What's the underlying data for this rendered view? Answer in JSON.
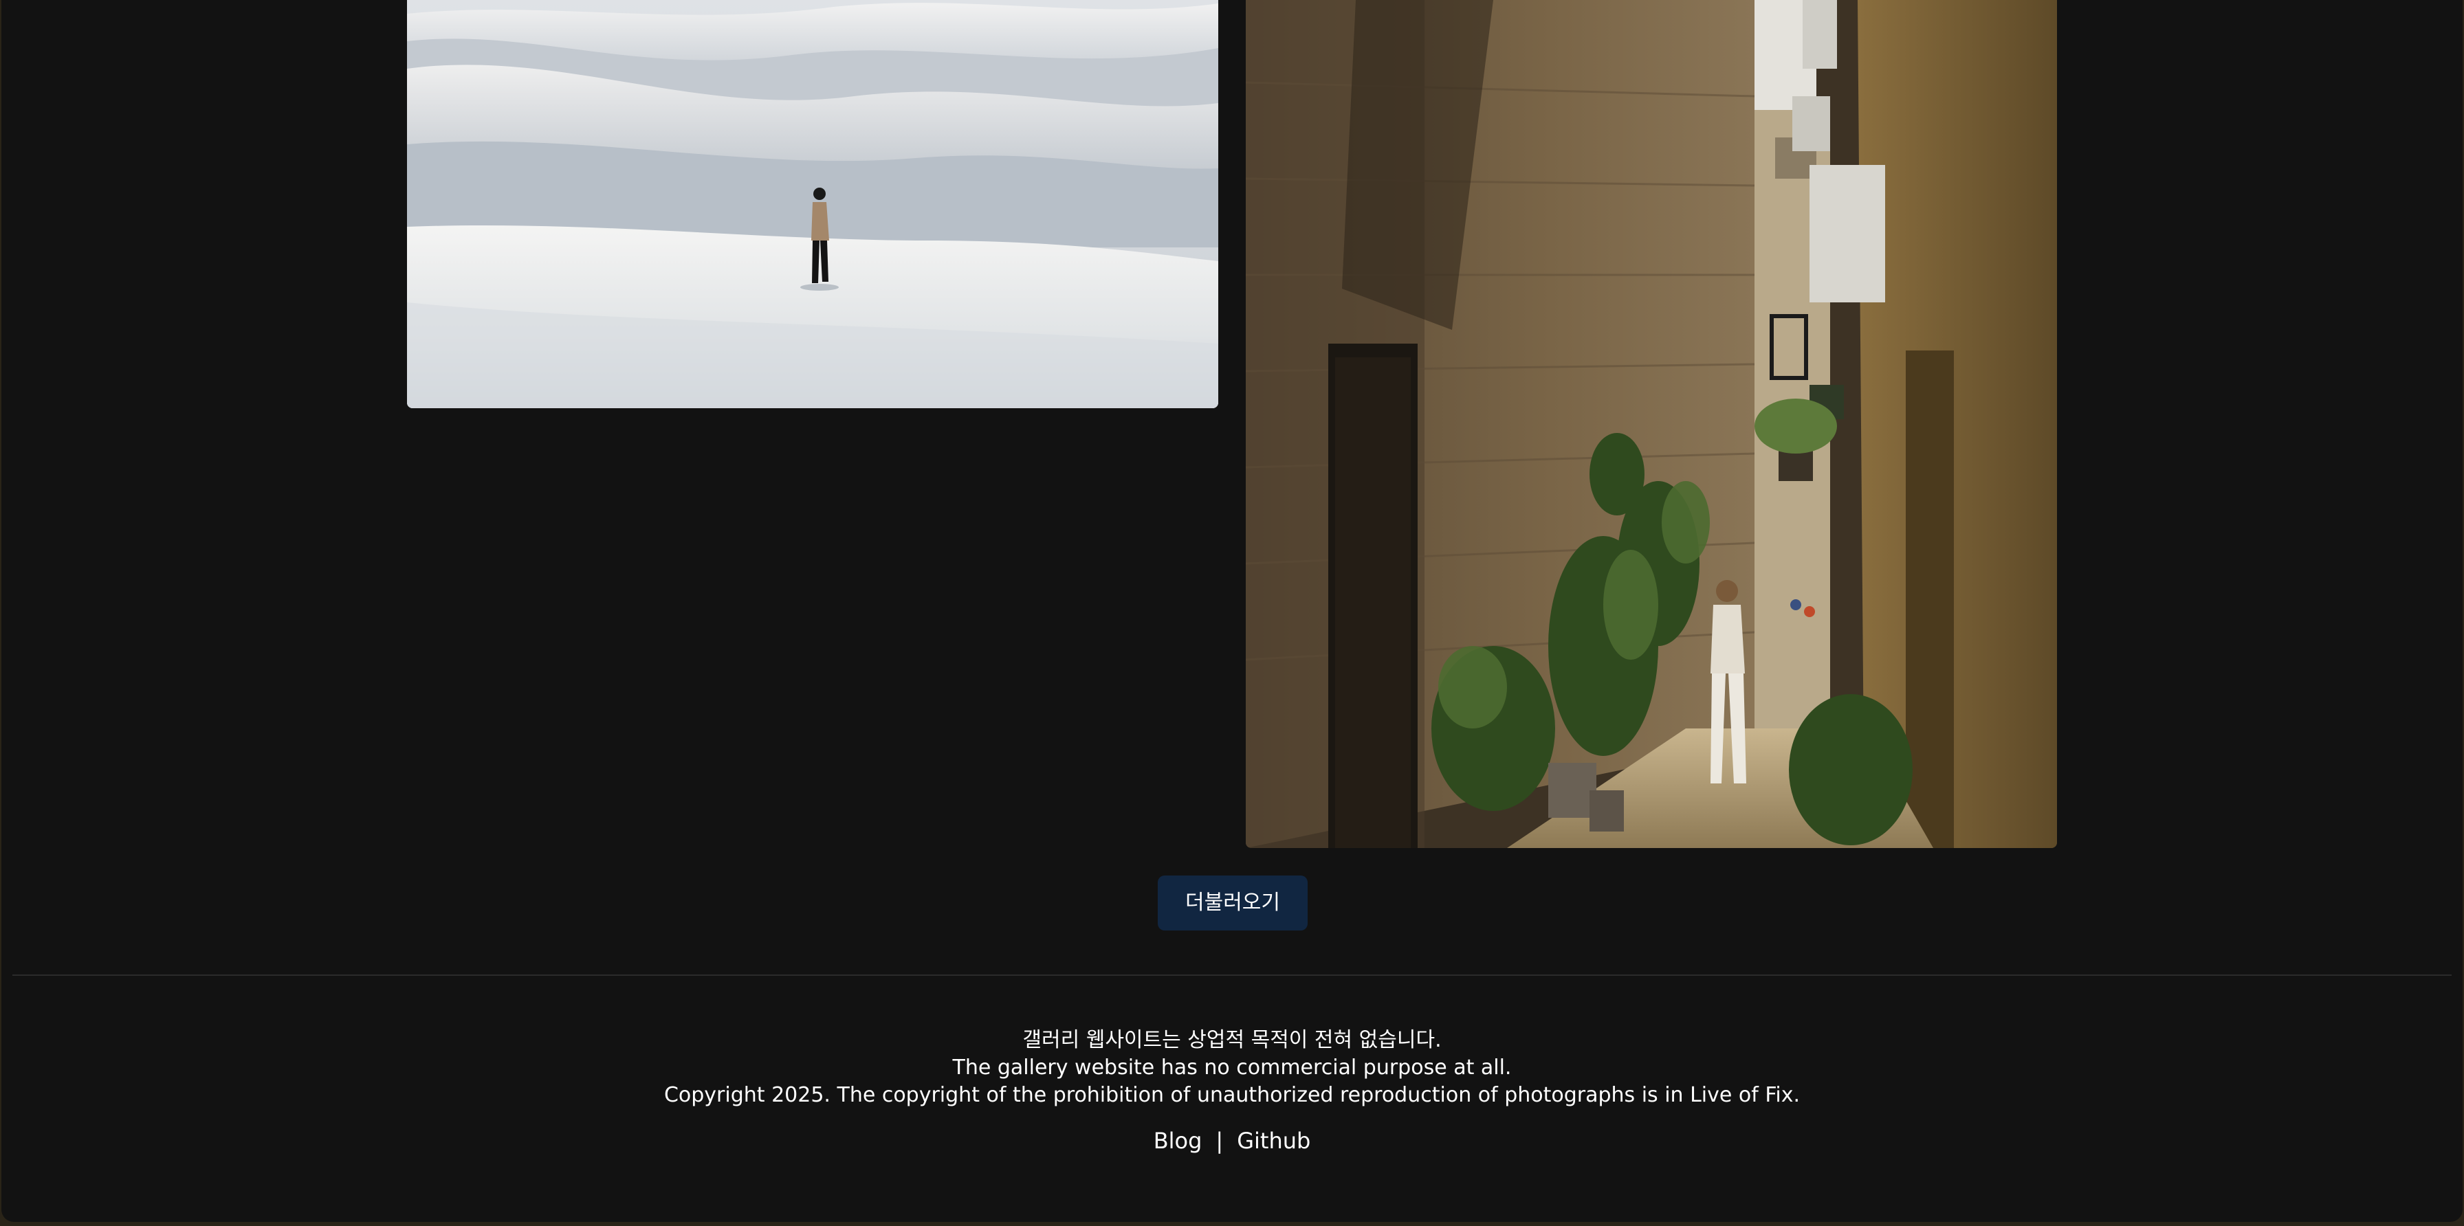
{
  "gallery": {
    "photos": [
      {
        "subject": "person walking across white sand dunes"
      },
      {
        "subject": "narrow stone alley with potted plants and a man walking"
      }
    ],
    "load_more_label": "더불러오기"
  },
  "footer": {
    "notice_ko": "갤러리 웹사이트는 상업적 목적이 전혀 없습니다.",
    "notice_en": "The gallery website has no commercial purpose at all.",
    "copyright": "Copyright 2025. The copyright of the prohibition of unauthorized reproduction of photographs is in Live of Fix.",
    "links": {
      "blog": "Blog",
      "separator": "|",
      "github": "Github"
    }
  },
  "colors": {
    "background": "#121212",
    "button": "#112641",
    "text": "#ffffff"
  }
}
